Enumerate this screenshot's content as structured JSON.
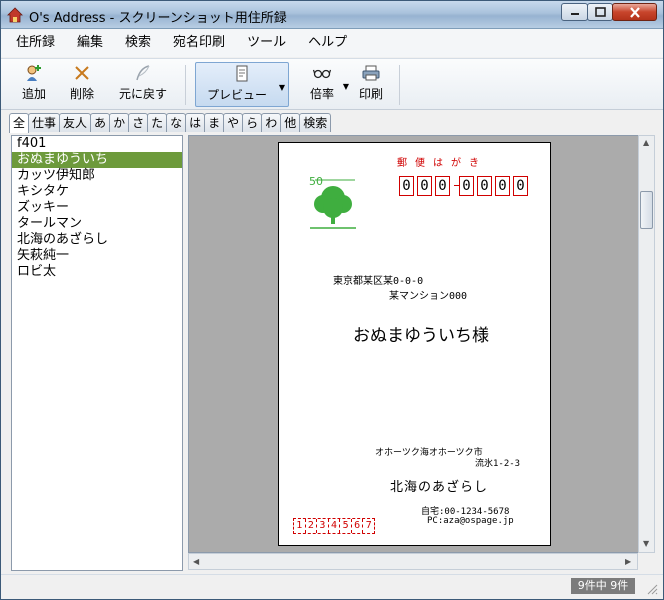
{
  "window": {
    "title": "O's Address - スクリーンショット用住所録",
    "colors": {
      "titlebar": "#a9c2dc",
      "close_button": "#c8452c",
      "selected_row": "#6d9a3b",
      "postal_red": "#d00000",
      "stamp_green": "#3fae3f"
    }
  },
  "menubar": {
    "items": [
      "住所録",
      "編集",
      "検索",
      "宛名印刷",
      "ツール",
      "ヘルプ"
    ]
  },
  "toolbar": {
    "add": "追加",
    "delete": "削除",
    "undo": "元に戻す",
    "preview": "プレビュー",
    "zoom": "倍率",
    "print": "印刷"
  },
  "tabs": [
    "全",
    "仕事",
    "友人",
    "あ",
    "か",
    "さ",
    "た",
    "な",
    "は",
    "ま",
    "や",
    "ら",
    "わ",
    "他",
    "検索"
  ],
  "contacts": {
    "selected_index": 1,
    "items": [
      "f401",
      "おぬまゆういち",
      "カッツ伊知郎",
      "キシタケ",
      "ズッキー",
      "タールマン",
      "北海のあざらし",
      "矢萩純一",
      "ロビ太"
    ]
  },
  "postcard": {
    "stamp_value": "50",
    "postal_title": "郵便はがき",
    "zip_digits": [
      "0",
      "0",
      "0",
      "0",
      "0",
      "0",
      "0"
    ],
    "address_line1": "東京都某区某0-0-0",
    "address_line2": "某マンション000",
    "recipient": "おぬまゆういち様",
    "sender_address_line1": "オホーツク海オホーツク市",
    "sender_address_line2": "流氷1-2-3",
    "sender_name": "北海のあざらし",
    "sender_phone": "自宅:00-1234-5678",
    "sender_email": "PC:aza@ospage.jp",
    "sender_zip_digits": [
      "1",
      "2",
      "3",
      "4",
      "5",
      "6",
      "7"
    ]
  },
  "status": {
    "count": "9件中 9件"
  }
}
